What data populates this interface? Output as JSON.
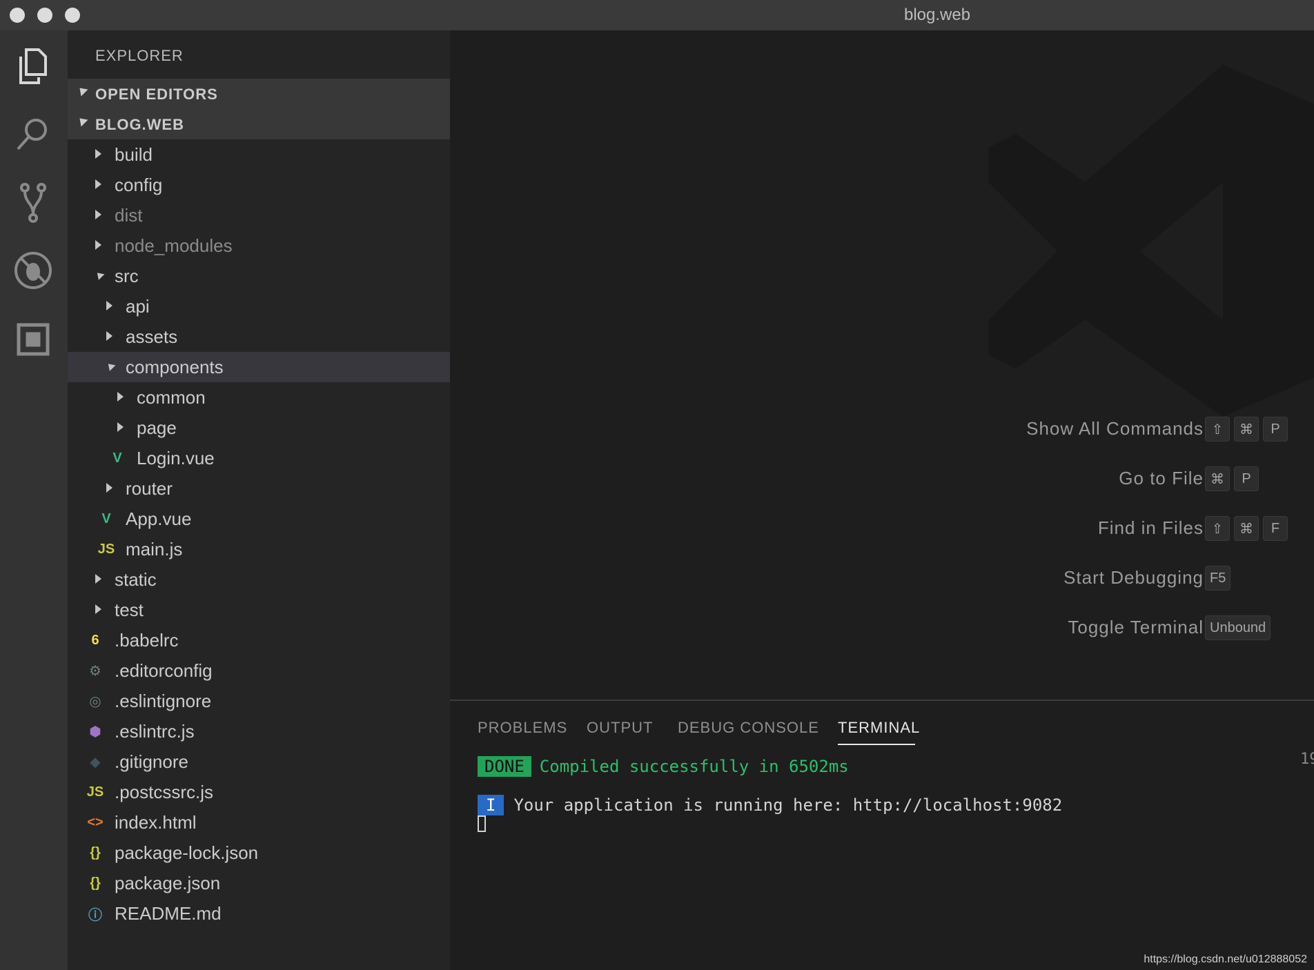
{
  "window": {
    "title": "blog.web"
  },
  "activity": [
    {
      "name": "explorer-icon"
    },
    {
      "name": "search-icon"
    },
    {
      "name": "source-control-icon"
    },
    {
      "name": "debug-icon"
    },
    {
      "name": "extensions-icon"
    }
  ],
  "sidebar": {
    "title": "EXPLORER",
    "open_editors": "OPEN EDITORS",
    "project": "BLOG.WEB",
    "tree": [
      {
        "label": "build",
        "kind": "folder",
        "expanded": false,
        "depth": 0
      },
      {
        "label": "config",
        "kind": "folder",
        "expanded": false,
        "depth": 0
      },
      {
        "label": "dist",
        "kind": "folder",
        "expanded": false,
        "depth": 0,
        "dim": true
      },
      {
        "label": "node_modules",
        "kind": "folder",
        "expanded": false,
        "depth": 0,
        "dim": true
      },
      {
        "label": "src",
        "kind": "folder",
        "expanded": true,
        "depth": 0
      },
      {
        "label": "api",
        "kind": "folder",
        "expanded": false,
        "depth": 1
      },
      {
        "label": "assets",
        "kind": "folder",
        "expanded": false,
        "depth": 1
      },
      {
        "label": "components",
        "kind": "folder",
        "expanded": true,
        "depth": 1,
        "selected": true
      },
      {
        "label": "common",
        "kind": "folder",
        "expanded": false,
        "depth": 2
      },
      {
        "label": "page",
        "kind": "folder",
        "expanded": false,
        "depth": 2
      },
      {
        "label": "Login.vue",
        "kind": "vue",
        "depth": 2
      },
      {
        "label": "router",
        "kind": "folder",
        "expanded": false,
        "depth": 1
      },
      {
        "label": "App.vue",
        "kind": "vue",
        "depth": 1
      },
      {
        "label": "main.js",
        "kind": "js",
        "depth": 1
      },
      {
        "label": "static",
        "kind": "folder",
        "expanded": false,
        "depth": 0
      },
      {
        "label": "test",
        "kind": "folder",
        "expanded": false,
        "depth": 0
      },
      {
        "label": ".babelrc",
        "kind": "babel",
        "depth": 0
      },
      {
        "label": ".editorconfig",
        "kind": "gear",
        "depth": 0
      },
      {
        "label": ".eslintignore",
        "kind": "eslintignore",
        "depth": 0
      },
      {
        "label": ".eslintrc.js",
        "kind": "eslint",
        "depth": 0
      },
      {
        "label": ".gitignore",
        "kind": "git",
        "depth": 0
      },
      {
        "label": ".postcssrc.js",
        "kind": "js",
        "depth": 0
      },
      {
        "label": "index.html",
        "kind": "html",
        "depth": 0
      },
      {
        "label": "package-lock.json",
        "kind": "json",
        "depth": 0
      },
      {
        "label": "package.json",
        "kind": "json",
        "depth": 0
      },
      {
        "label": "README.md",
        "kind": "info",
        "depth": 0
      }
    ]
  },
  "shortcuts": [
    {
      "label": "Show All Commands",
      "keys": [
        "⇧",
        "⌘",
        "P"
      ]
    },
    {
      "label": "Go to File",
      "keys": [
        "⌘",
        "P"
      ]
    },
    {
      "label": "Find in Files",
      "keys": [
        "⇧",
        "⌘",
        "F"
      ]
    },
    {
      "label": "Start Debugging",
      "keys": [
        "F5"
      ]
    },
    {
      "label": "Toggle Terminal",
      "keys": [
        "Unbound"
      ]
    }
  ],
  "panel": {
    "tabs": [
      "PROBLEMS",
      "OUTPUT",
      "DEBUG CONSOLE",
      "TERMINAL"
    ],
    "active_tab": "TERMINAL",
    "terminal": {
      "done_badge": "DONE",
      "done_text": "Compiled successfully in 6502ms",
      "info_badge": "I",
      "info_text": "Your application is running here: http://localhost:9082",
      "edge_number": "19"
    }
  },
  "watermark": "https://blog.csdn.net/u012888052",
  "colors": {
    "vue": "#41b883",
    "js": "#cbcb41",
    "babel": "#f5da55",
    "html": "#e37933",
    "json": "#cbcb41",
    "eslint": "#a074c4",
    "info": "#519aba",
    "gear": "#6d8086",
    "git": "#41535b",
    "done": "#23a35a",
    "info_badge": "#2869c5"
  }
}
